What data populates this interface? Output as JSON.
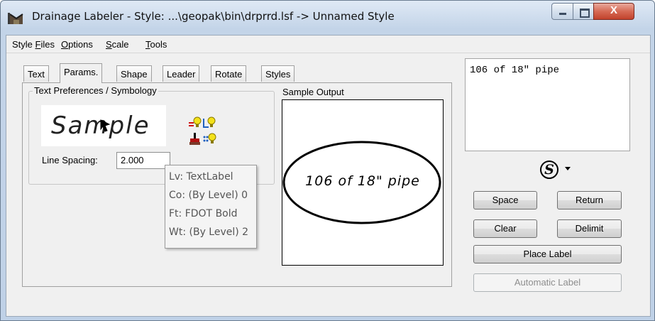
{
  "window": {
    "title": "Drainage Labeler - Style: ...\\geopak\\bin\\drprrd.lsf -> Unnamed Style",
    "close_glyph": "X"
  },
  "menu": [
    {
      "pre": "Style ",
      "key": "F",
      "post": "iles"
    },
    {
      "pre": "",
      "key": "O",
      "post": "ptions"
    },
    {
      "pre": "",
      "key": "S",
      "post": "cale"
    },
    {
      "pre": "",
      "key": "T",
      "post": "ools"
    }
  ],
  "tabs": [
    "Text",
    "Params.",
    "Shape",
    "Leader",
    "Rotate",
    "Styles"
  ],
  "active_tab": "Params.",
  "text_prefs": {
    "group_label": "Text Preferences / Symbology",
    "sample_text": "Sample",
    "line_spacing_label": "Line Spacing:",
    "line_spacing_value": "2.000"
  },
  "tooltip": {
    "lines": [
      "Lv: TextLabel",
      "Co: (By Level) 0",
      "Ft: FDOT Bold",
      "Wt: (By Level) 2"
    ]
  },
  "sample_output": {
    "label": "Sample Output",
    "text": "106 of 18\" pipe"
  },
  "label_text": "106 of 18\" pipe",
  "buttons": {
    "space": "Space",
    "return": "Return",
    "clear": "Clear",
    "delimit": "Delimit",
    "place_label": "Place Label",
    "automatic_label": "Automatic Label"
  },
  "icons": {
    "app": "drainage-app-icon",
    "s_symbol": "S",
    "lightbulb_color": "#e8c800",
    "brush_color": "#b01010"
  }
}
